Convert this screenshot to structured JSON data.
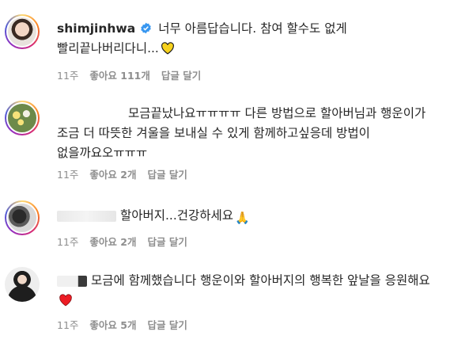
{
  "comments": [
    {
      "username": "shimjinhwa",
      "verified": true,
      "text": "너무 아름답습니다. 참여 할수도 없게 빨리끝나버리다니...",
      "emoji": "yellow-heart",
      "time": "11주",
      "likes": "좋아요 111개",
      "reply": "답글 달기"
    },
    {
      "text": "모금끝났나요ㅠㅠㅠㅠ 다른 방법으로 할아버님과 행운이가 조금 더 따뜻한 겨울을 보내실 수 있게 함께하고싶응데 방법이 없을까요오ㅠㅠㅠ",
      "time": "11주",
      "likes": "좋아요 2개",
      "reply": "답글 달기"
    },
    {
      "text": "할아버지...건강하세요",
      "emoji": "folded-hands",
      "time": "11주",
      "likes": "좋아요 2개",
      "reply": "답글 달기"
    },
    {
      "text": "모금에 함께했습니다 행운이와 할아버지의 행복한 앞날을 응원해요",
      "emoji": "red-heart",
      "time": "11주",
      "likes": "좋아요 5개",
      "reply": "답글 달기"
    }
  ],
  "colors": {
    "text": "#262626",
    "meta": "#8e8e8e",
    "verified": "#3897f0",
    "yellow_heart": "#f7d21e",
    "red_heart": "#ed1c24"
  }
}
